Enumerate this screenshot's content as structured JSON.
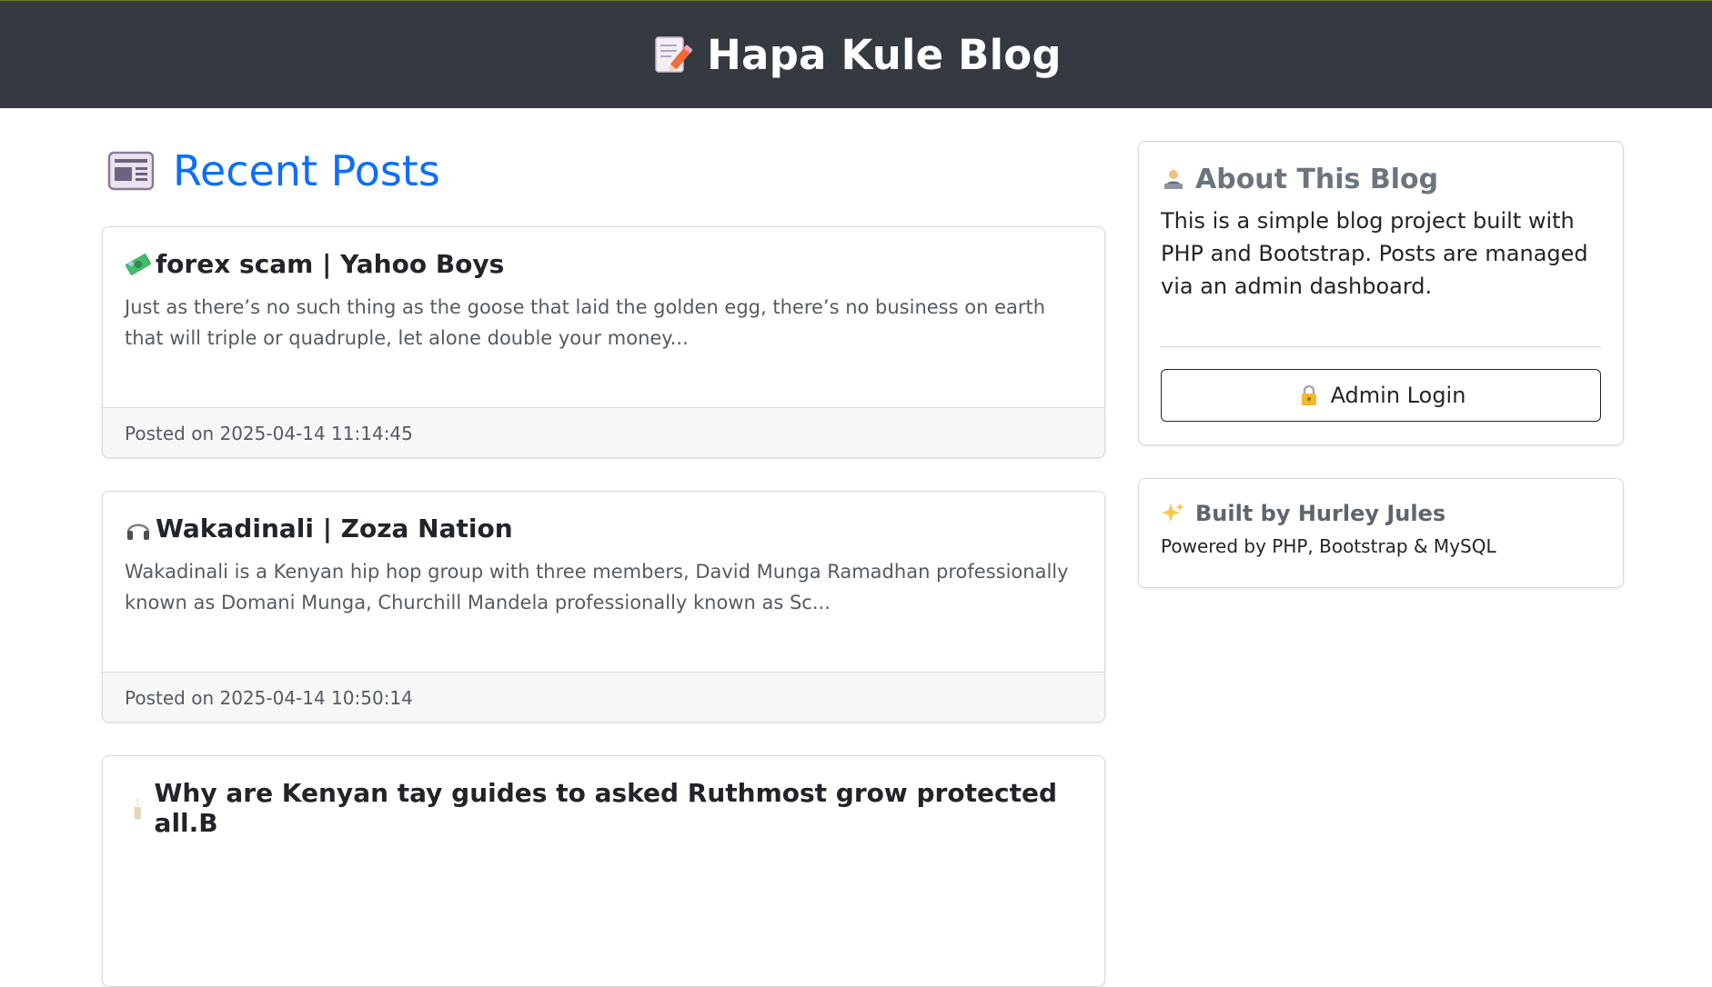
{
  "header": {
    "title": "Hapa Kule Blog",
    "icon": "memo-pencil-icon"
  },
  "main": {
    "heading": "Recent Posts",
    "heading_icon": "newspaper-icon",
    "posts": [
      {
        "icon": "money-bill-icon",
        "title": "forex scam | Yahoo Boys",
        "excerpt": "Just as there’s no such thing as the goose that laid the golden egg, there’s no business on earth that will triple or quadruple, let alone double your money...",
        "footer": "Posted on 2025-04-14 11:14:45"
      },
      {
        "icon": "headphones-icon",
        "title": "Wakadinali | Zoza Nation",
        "excerpt": "Wakadinali is a Kenyan hip hop group with three members, David Munga Ramadhan professionally known as Domani Munga, Churchill Mandela professionally known as Sc...",
        "footer": "Posted on 2025-04-14 10:50:14"
      },
      {
        "icon": "candle-icon",
        "title": "Why are Kenyan tay guides to asked Ruthmost grow protected all.B",
        "excerpt": "",
        "footer": ""
      }
    ]
  },
  "sidebar": {
    "about": {
      "icon": "technologist-icon",
      "title": "About This Blog",
      "text": "This is a simple blog project built with PHP and Bootstrap. Posts are managed via an admin dashboard.",
      "button_icon": "lock-icon",
      "button_label": "Admin Login"
    },
    "built": {
      "icon": "sparkles-icon",
      "title": "Built by Hurley Jules",
      "text": "Powered by PHP, Bootstrap & MySQL"
    }
  },
  "colors": {
    "navbar": "#343a40",
    "primary": "#0d6efd",
    "muted": "#6c757d",
    "card_border": "#d7d9db",
    "footer_bg": "#f6f7f7"
  }
}
